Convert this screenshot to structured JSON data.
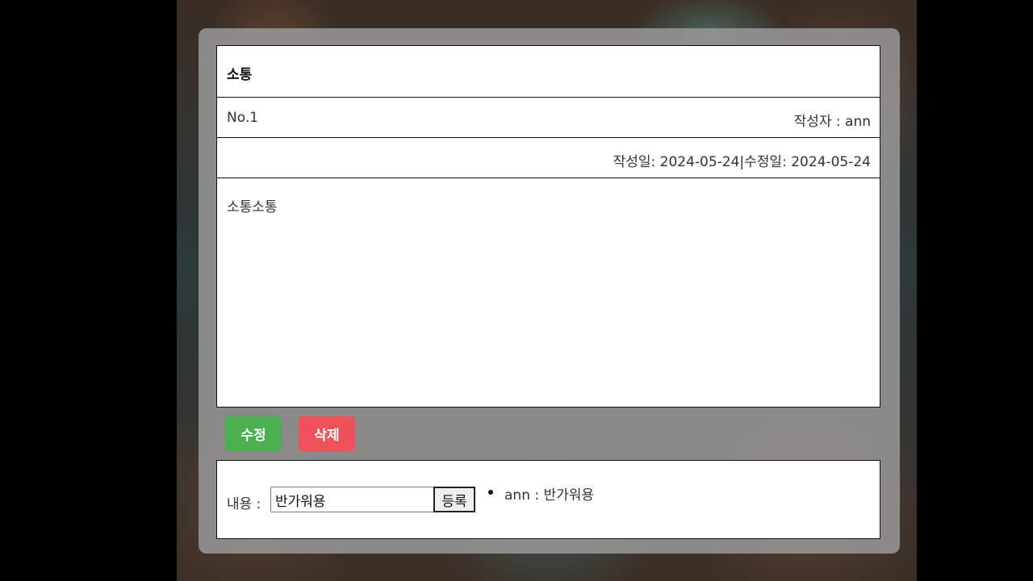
{
  "post": {
    "title": "소통",
    "number": "No.1",
    "author": "작성자 : ann",
    "dates": "작성일: 2024-05-24|수정일: 2024-05-24",
    "content": "소통소통"
  },
  "actions": {
    "edit_label": "수정",
    "delete_label": "삭제"
  },
  "comment_form": {
    "label": "내용 :",
    "input_value": "반가워용",
    "submit_label": "등록"
  },
  "comments": [
    {
      "text": "ann : 반가워용"
    }
  ],
  "colors": {
    "edit_button": "#4caf50",
    "delete_button": "#f0525a",
    "card_background": "#969696"
  }
}
